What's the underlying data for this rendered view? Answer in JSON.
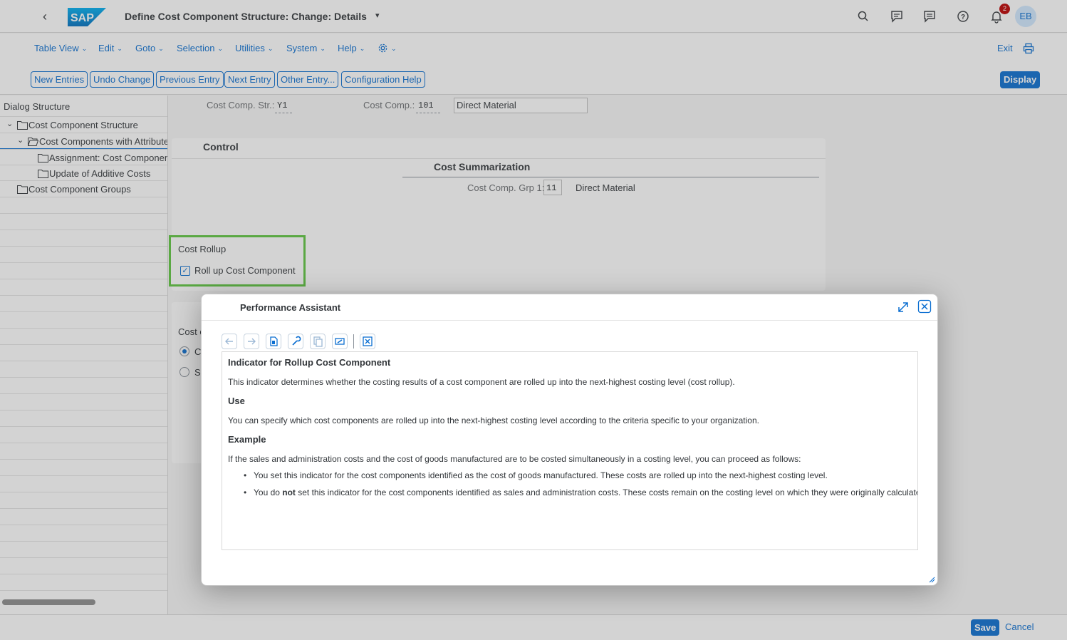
{
  "shell": {
    "title": "Define Cost Component Structure: Change: Details",
    "notification_count": "2",
    "avatar_initials": "EB"
  },
  "menu": {
    "items": [
      "Table View",
      "Edit",
      "Goto",
      "Selection",
      "Utilities",
      "System",
      "Help"
    ],
    "exit": "Exit"
  },
  "toolbar": {
    "new_entries": "New Entries",
    "undo_change": "Undo Change",
    "previous_entry": "Previous Entry",
    "next_entry": "Next Entry",
    "other_entry": "Other Entry...",
    "configuration_help": "Configuration Help",
    "display": "Display"
  },
  "dialog_structure": {
    "header": "Dialog Structure",
    "items": [
      "Cost Component Structure",
      "Cost Components with Attributes",
      "Assignment: Cost Component",
      "Update of Additive Costs",
      "Cost Component Groups"
    ]
  },
  "header_fields": {
    "cost_comp_str_label": "Cost Comp. Str.:",
    "cost_comp_str_value": "Y1",
    "cost_comp_label": "Cost Comp.:",
    "cost_comp_value": "101",
    "cost_comp_desc": "Direct Material"
  },
  "control": {
    "title": "Control",
    "cost_summarization_title": "Cost Summarization",
    "grp1_label": "Cost Comp. Grp 1:",
    "grp1_value": "11",
    "grp1_desc": "Direct Material"
  },
  "cost_rollup": {
    "title": "Cost Rollup",
    "checkbox_label": "Roll up Cost Component",
    "checked": true
  },
  "partial_section": {
    "label_fragment": "Cost c",
    "radio1_fragment": "C",
    "radio2_fragment": "S"
  },
  "dialog": {
    "title": "Performance Assistant",
    "doc_title": "Indicator for Rollup Cost Component",
    "doc_intro": "This indicator determines whether the costing results of a cost component are rolled up into the next-highest costing level (cost rollup).",
    "use_heading": "Use",
    "use_text": "You can specify which cost components are rolled up into the next-highest costing level according to the criteria specific to your organization.",
    "example_heading": "Example",
    "example_text": "If the sales and administration costs and the cost of goods manufactured are to be costed simultaneously in a costing level, you can proceed as follows:",
    "bullet1": "You set this indicator for the cost components identified as the cost of goods manufactured. These costs are rolled up into the next-highest costing level.",
    "bullet2_pre": "You do ",
    "bullet2_bold": "not",
    "bullet2_post": " set this indicator for the cost components identified as sales and administration costs. These costs remain on the costing level on which they were originally calculated."
  },
  "footer": {
    "save": "Save",
    "cancel": "Cancel"
  },
  "colors": {
    "accent": "#0a6ed1",
    "highlight_box": "#5ec63f",
    "badge": "#bb0000"
  }
}
